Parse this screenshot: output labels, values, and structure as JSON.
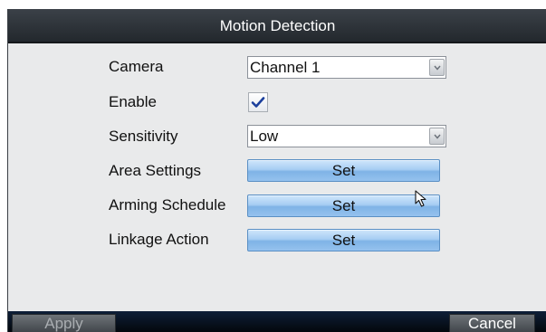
{
  "dialog": {
    "title": "Motion Detection"
  },
  "fields": {
    "camera": {
      "label": "Camera",
      "value": "Channel 1"
    },
    "enable": {
      "label": "Enable",
      "checked": true
    },
    "sensitivity": {
      "label": "Sensitivity",
      "value": "Low"
    },
    "area_settings": {
      "label": "Area Settings",
      "button": "Set"
    },
    "arming_schedule": {
      "label": "Arming Schedule",
      "button": "Set"
    },
    "linkage_action": {
      "label": "Linkage Action",
      "button": "Set"
    }
  },
  "footer": {
    "apply_label": "Apply",
    "cancel_label": "Cancel"
  },
  "icons": {
    "dropdown": "chevron-down-icon",
    "check": "checkmark-icon",
    "cursor": "mouse-pointer-icon"
  },
  "colors": {
    "title_bar": "#2e3339",
    "panel": "#e9eaeb",
    "button_blue": "#a7cdf3",
    "check_blue": "#1b3f9c"
  }
}
